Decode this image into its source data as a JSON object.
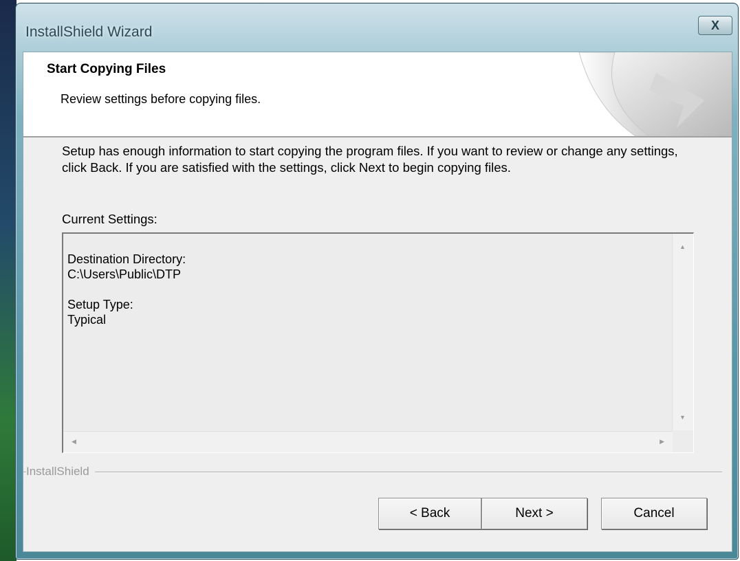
{
  "window": {
    "title": "InstallShield Wizard",
    "close_glyph": "X"
  },
  "header": {
    "title": "Start Copying Files",
    "subtitle": "Review settings before copying files."
  },
  "body": {
    "instructions": "Setup has enough information to start copying the program files.  If you want to review or change any settings, click Back.  If you are satisfied with the settings, click Next to begin copying files.",
    "current_settings_label": "Current Settings:"
  },
  "settings": [
    {
      "name": "Destination Directory:",
      "value": "C:\\Users\\Public\\DTP"
    },
    {
      "name": "Setup Type:",
      "value": "Typical"
    }
  ],
  "footer": {
    "brand": "InstallShield"
  },
  "buttons": {
    "back": "< Back",
    "next": "Next >",
    "cancel": "Cancel"
  },
  "icons": {
    "close": "close-icon",
    "wizard_graphic": "page-curl-arrow-graphic"
  }
}
